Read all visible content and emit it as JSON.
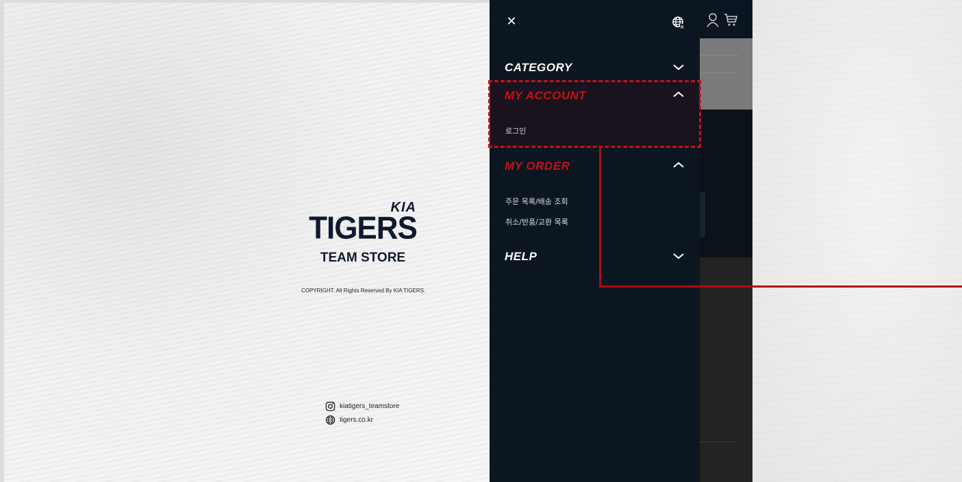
{
  "brand": {
    "kia_logo": "KIA",
    "name": "TIGERS",
    "subtitle": "TEAM STORE",
    "copyright": "COPYRIGHT. All Rights Reserved By KIA TIGERS."
  },
  "social": {
    "instagram": "kiatigers_teamstore",
    "website": "tigers.co.kr"
  },
  "menu": {
    "close_label": "✕",
    "sections": {
      "category": {
        "title": "CATEGORY",
        "expanded": false
      },
      "my_account": {
        "title": "MY ACCOUNT",
        "expanded": true,
        "items": [
          "로그인"
        ]
      },
      "my_order": {
        "title": "MY ORDER",
        "expanded": true,
        "items": [
          "주문 목록/배송 조회",
          "취소/반품/교환 목록"
        ]
      },
      "help": {
        "title": "HELP",
        "expanded": false
      }
    }
  },
  "colors": {
    "panel_bg": "#0b1620",
    "accent_red": "#c4111b",
    "text_white": "#ffffff",
    "brand_navy": "#0f1a2e"
  },
  "icons": {
    "close": "close-icon",
    "language": "globe-icon",
    "user": "user-icon",
    "cart": "cart-icon",
    "chevron_down": "chevron-down-icon",
    "chevron_up": "chevron-up-icon"
  }
}
